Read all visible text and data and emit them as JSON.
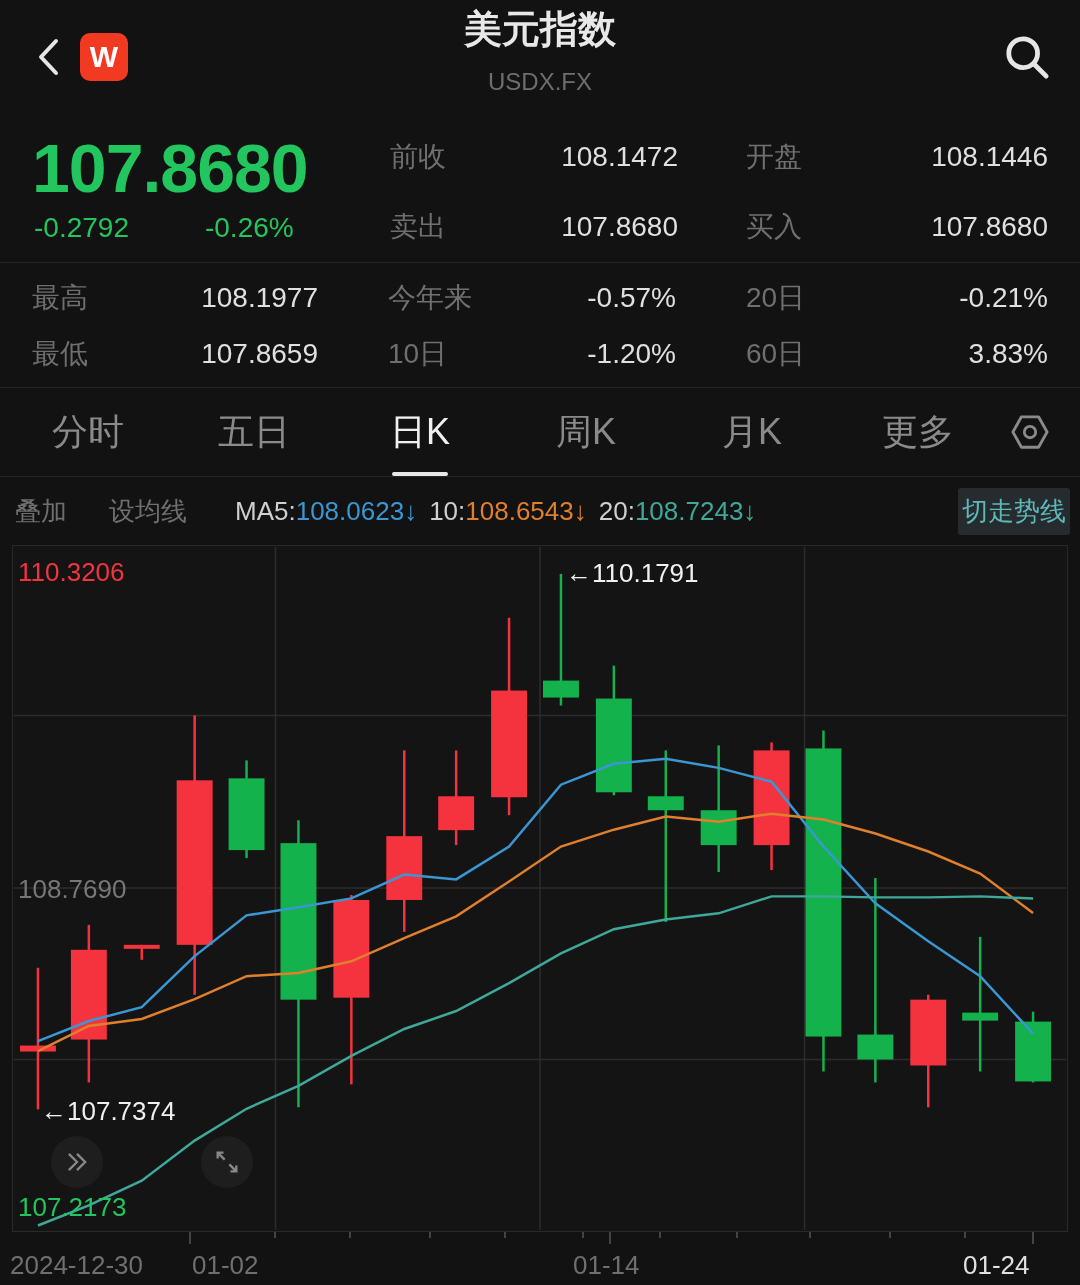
{
  "header": {
    "title": "美元指数",
    "subtitle": "USDX.FX",
    "logo": "W"
  },
  "quote": {
    "price": "107.8680",
    "change": "-0.2792",
    "change_pct": "-0.26%"
  },
  "fields": [
    {
      "label": "前收",
      "value": "108.1472"
    },
    {
      "label": "开盘",
      "value": "108.1446"
    },
    {
      "label": "卖出",
      "value": "107.8680"
    },
    {
      "label": "买入",
      "value": "107.8680"
    }
  ],
  "stats": [
    {
      "label": "最高",
      "value": "108.1977"
    },
    {
      "label": "今年来",
      "value": "-0.57%"
    },
    {
      "label": "20日",
      "value": "-0.21%"
    },
    {
      "label": "最低",
      "value": "107.8659"
    },
    {
      "label": "10日",
      "value": "-1.20%"
    },
    {
      "label": "60日",
      "value": "3.83%"
    }
  ],
  "tabs": [
    {
      "label": "分时",
      "selected": false
    },
    {
      "label": "五日",
      "selected": false
    },
    {
      "label": "日K",
      "selected": true
    },
    {
      "label": "周K",
      "selected": false
    },
    {
      "label": "月K",
      "selected": false
    },
    {
      "label": "更多",
      "selected": false
    }
  ],
  "toolbar": {
    "items": [
      "叠加",
      "设均线"
    ],
    "switch_button": "切走势线"
  },
  "ma": [
    {
      "separator": ":",
      "value": "108.0623",
      "arrow": "↓"
    },
    {
      "separator": ":",
      "value": "108.6543",
      "arrow": "↓"
    },
    {
      "separator": ":",
      "value": "108.7243",
      "arrow": "↓"
    }
  ],
  "chart": {
    "high_marker": "←110.1791",
    "low_marker": "←107.7374",
    "chart_data": {
      "type": "line",
      "ylim": [
        107.095,
        110.452
      ],
      "yticks": [
        {
          "value": 110.3206,
          "label": "110.3206"
        },
        {
          "value": 108.769,
          "label": "108.7690"
        },
        {
          "value": 107.2173,
          "label": "107.2173"
        }
      ],
      "series": [
        {
          "name": "MA5",
          "color": "#3a97d4",
          "values": [
            108.026,
            108.124,
            108.192,
            108.442,
            108.642,
            108.681,
            108.725,
            108.842,
            108.818,
            108.979,
            109.282,
            109.385,
            109.409,
            109.365,
            109.297,
            108.979,
            108.701,
            108.515,
            108.344,
            108.062
          ]
        },
        {
          "name": "10",
          "color": "#e07f2c",
          "values": [
            107.977,
            108.1,
            108.134,
            108.231,
            108.344,
            108.359,
            108.417,
            108.53,
            108.637,
            108.808,
            108.979,
            109.062,
            109.126,
            109.101,
            109.14,
            109.111,
            109.043,
            108.955,
            108.847,
            108.654
          ]
        },
        {
          "name": "20",
          "color": "#3fa89a",
          "values": [
            107.122,
            107.22,
            107.342,
            107.538,
            107.694,
            107.806,
            107.953,
            108.085,
            108.173,
            108.31,
            108.456,
            108.574,
            108.622,
            108.652,
            108.735,
            108.735,
            108.73,
            108.73,
            108.735,
            108.724
          ]
        }
      ]
    }
  },
  "x_axis": [
    {
      "label": "2024-12-30",
      "current": false
    },
    {
      "label": "01-02",
      "current": false
    },
    {
      "label": "01-14",
      "current": false
    },
    {
      "label": "01-24",
      "current": true
    }
  ]
}
